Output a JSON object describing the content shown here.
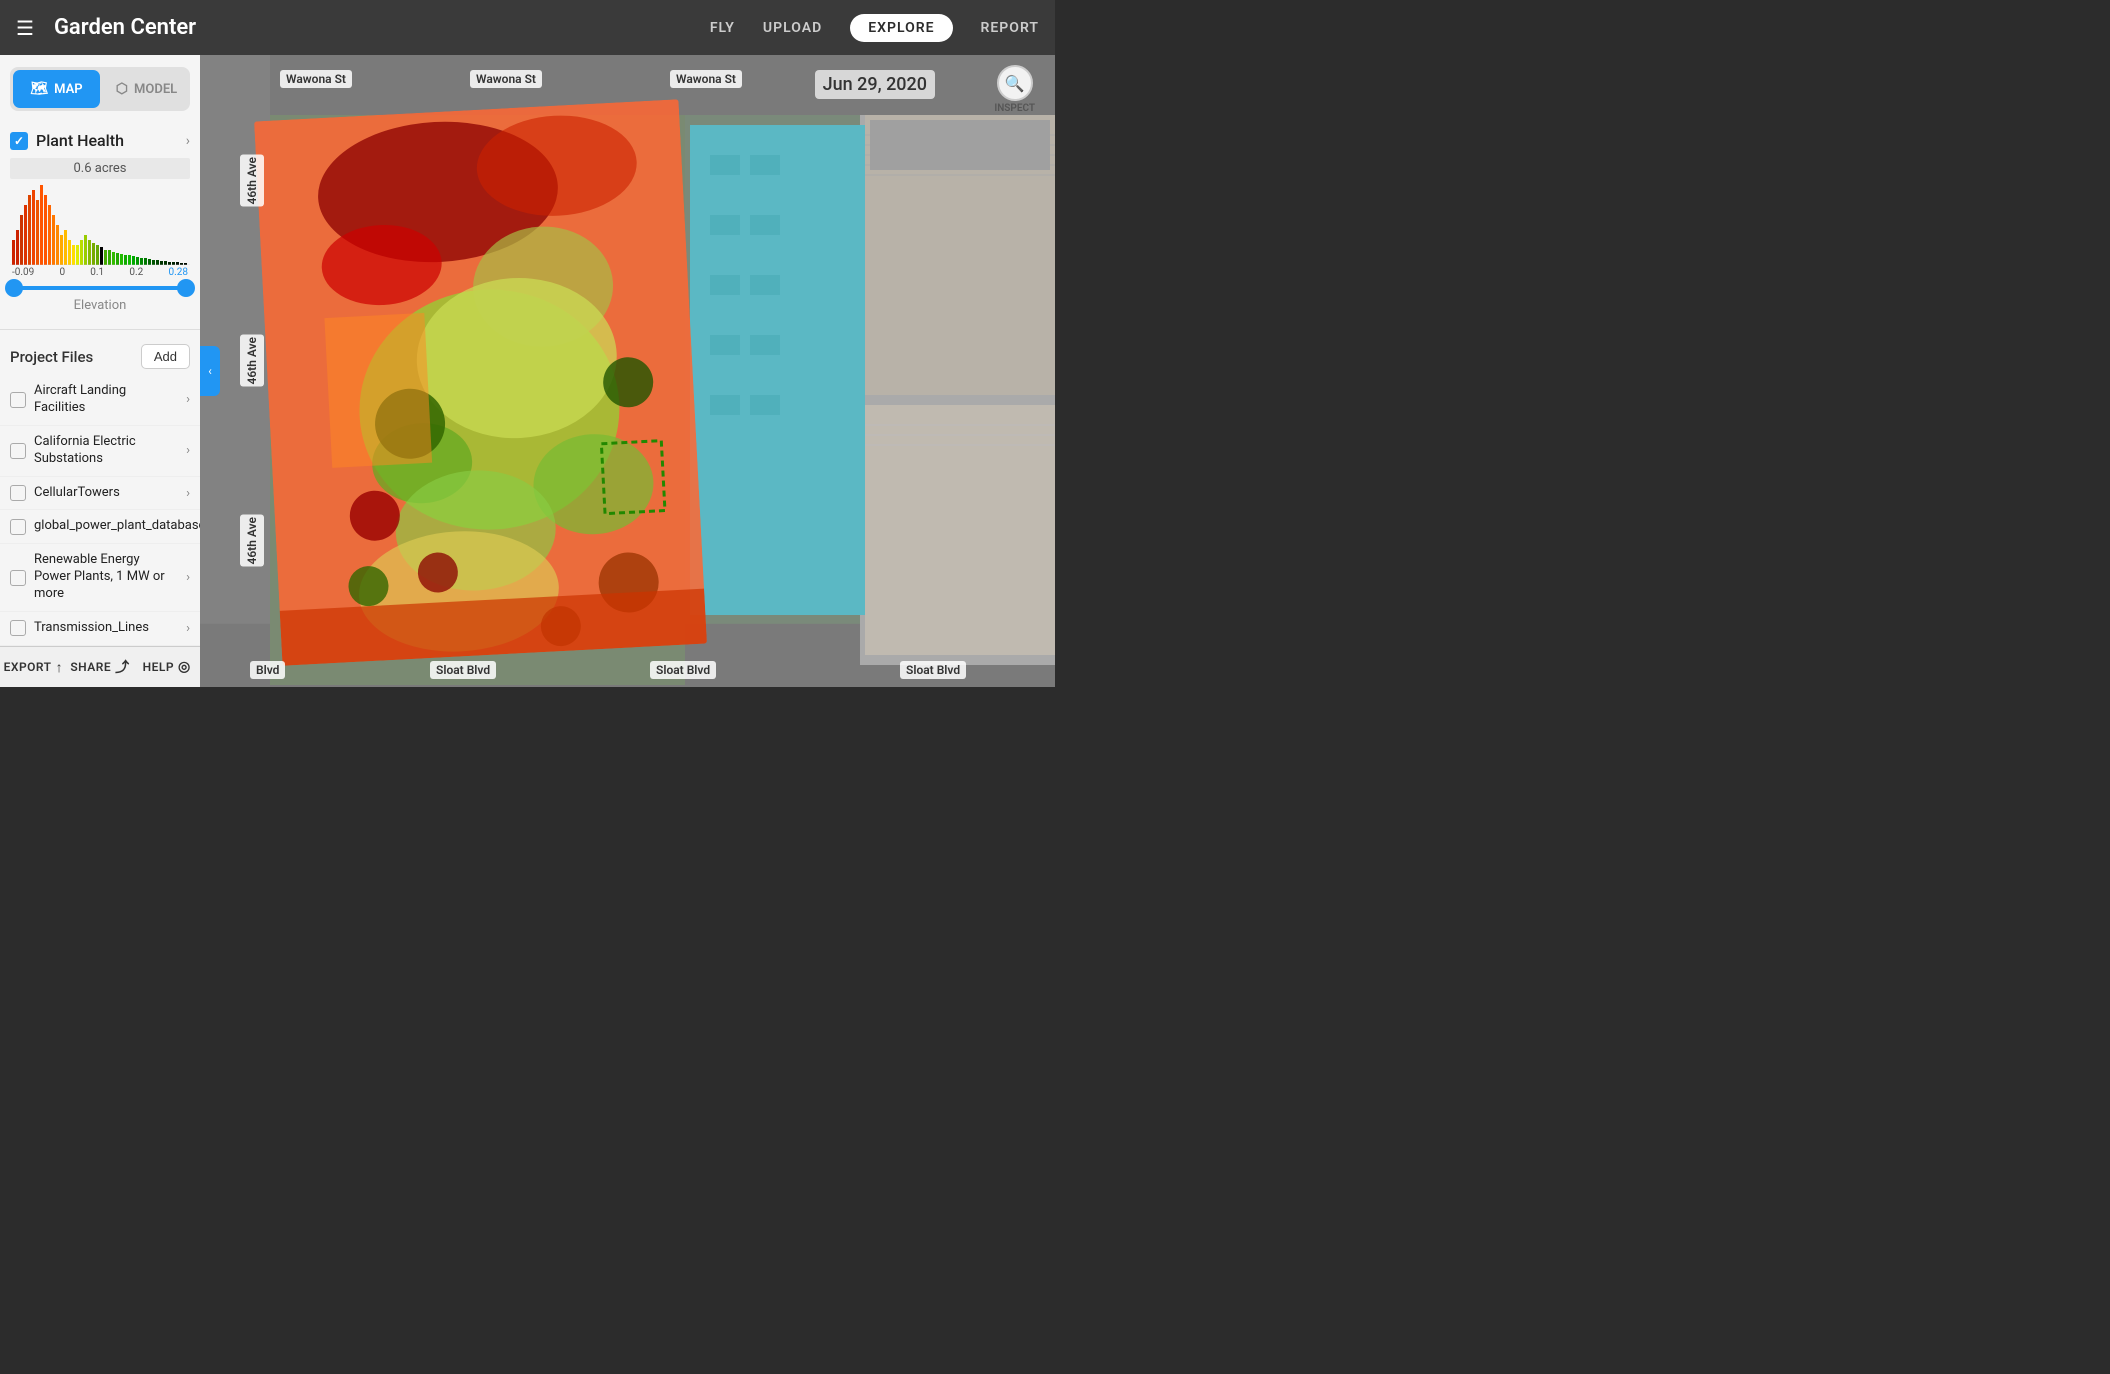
{
  "app": {
    "title": "Garden Center",
    "nav": {
      "fly": "FLY",
      "upload": "UPLOAD",
      "explore": "EXPLORE",
      "report": "REPORT"
    }
  },
  "sidebar": {
    "map_btn": "MAP",
    "model_btn": "MODEL",
    "plant_health": {
      "label": "Plant Health",
      "acres": "0.6 acres",
      "min_val": "-0.09",
      "zero_val": "0",
      "val_01": "0.1",
      "val_02": "0.2",
      "max_val": "0.28",
      "elevation_label": "Elevation"
    },
    "project_files": {
      "title": "Project Files",
      "add_btn": "Add",
      "items": [
        {
          "name": "Aircraft Landing Facilities"
        },
        {
          "name": "California Electric Substations"
        },
        {
          "name": "CellularTowers"
        },
        {
          "name": "global_power_plant_database"
        },
        {
          "name": "Renewable Energy Power Plants, 1 MW or more"
        },
        {
          "name": "Transmission_Lines"
        }
      ]
    },
    "bottom": {
      "export": "EXPORT",
      "share": "SHARE",
      "help": "HELP"
    }
  },
  "map": {
    "date": "Jun 29, 2020",
    "inspect_label": "INSPECT",
    "streets": {
      "wawona_1": "Wawona St",
      "wawona_2": "Wawona St",
      "wawona_3": "Wawona St",
      "ave_46_1": "46th Ave",
      "ave_46_2": "46th Ave",
      "ave_46_3": "46th Ave",
      "sloat_1": "Sloat Blvd",
      "sloat_2": "Sloat Blvd",
      "sloat_3": "Sloat Blvd",
      "sloat_4": "Sloat Blvd"
    }
  }
}
